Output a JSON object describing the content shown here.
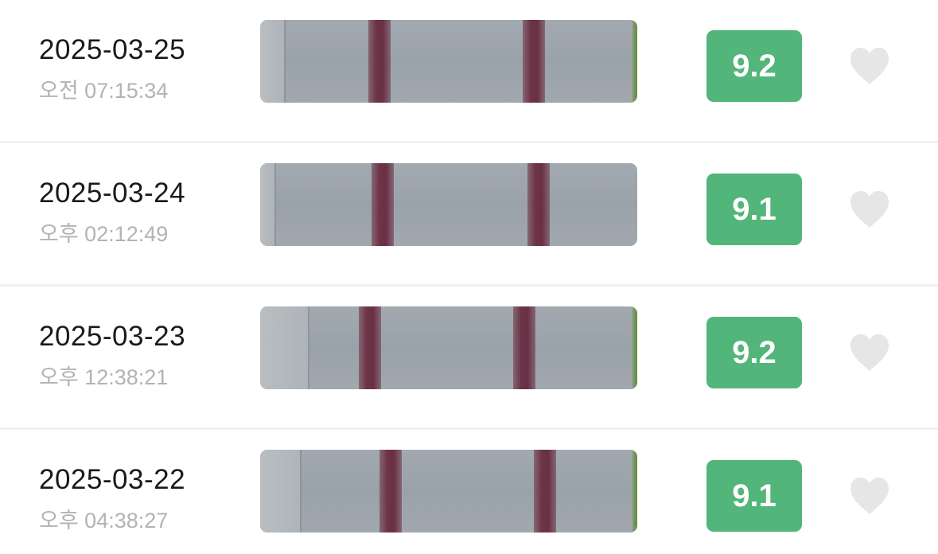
{
  "records": [
    {
      "date": "2025-03-25",
      "time": "오전 07:15:34",
      "score": "9.2",
      "favorite": false
    },
    {
      "date": "2025-03-24",
      "time": "오후 02:12:49",
      "score": "9.1",
      "favorite": false
    },
    {
      "date": "2025-03-23",
      "time": "오후 12:38:21",
      "score": "9.2",
      "favorite": false
    },
    {
      "date": "2025-03-22",
      "time": "오후 04:38:27",
      "score": "9.1",
      "favorite": false
    }
  ],
  "icons": {
    "favorite": "heart-icon"
  },
  "colors": {
    "score_badge": "#52b579",
    "heart_inactive": "#e6e6e6",
    "date_text": "#1a1a1a",
    "time_text": "#b3b3b3",
    "test_line": "#6d3447"
  }
}
